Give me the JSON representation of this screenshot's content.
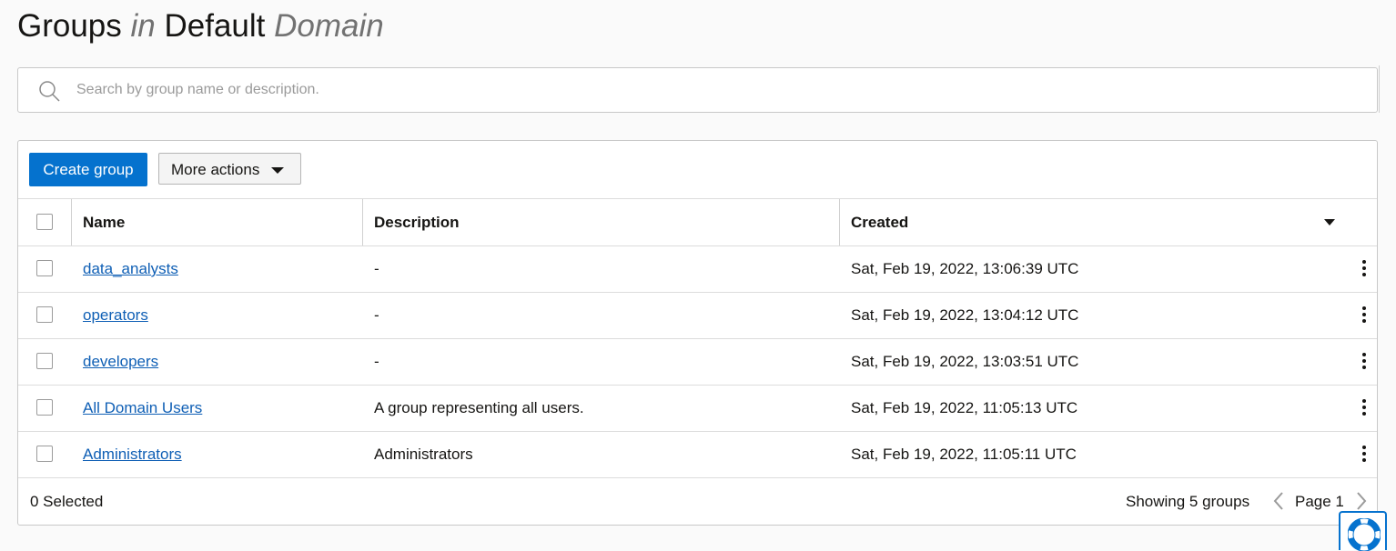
{
  "header": {
    "title_groups": "Groups",
    "title_in": "in",
    "title_domain_name": "Default",
    "title_domain": "Domain"
  },
  "search": {
    "placeholder": "Search by group name or description.",
    "value": ""
  },
  "toolbar": {
    "create_label": "Create group",
    "more_actions_label": "More actions"
  },
  "table": {
    "columns": [
      "Name",
      "Description",
      "Created"
    ],
    "rows": [
      {
        "name": "data_analysts",
        "description": "-",
        "created": "Sat, Feb 19, 2022, 13:06:39 UTC"
      },
      {
        "name": "operators",
        "description": "-",
        "created": "Sat, Feb 19, 2022, 13:04:12 UTC"
      },
      {
        "name": "developers",
        "description": "-",
        "created": "Sat, Feb 19, 2022, 13:03:51 UTC"
      },
      {
        "name": "All Domain Users",
        "description": "A group representing all users.",
        "created": "Sat, Feb 19, 2022, 11:05:13 UTC"
      },
      {
        "name": "Administrators",
        "description": "Administrators",
        "created": "Sat, Feb 19, 2022, 11:05:11 UTC"
      }
    ]
  },
  "footer": {
    "selected": "0 Selected",
    "showing": "Showing 5 groups",
    "page": "Page 1"
  },
  "icons": {
    "search": "search-icon",
    "dropdown": "caret-down-icon",
    "sort": "sort-caret-icon",
    "row_actions": "kebab-menu-icon",
    "prev": "chevron-left-icon",
    "next": "chevron-right-icon",
    "help": "lifebuoy-help-icon"
  },
  "colors": {
    "primary": "#0572ce",
    "link": "#0f5fb5",
    "background": "#fafafa"
  }
}
